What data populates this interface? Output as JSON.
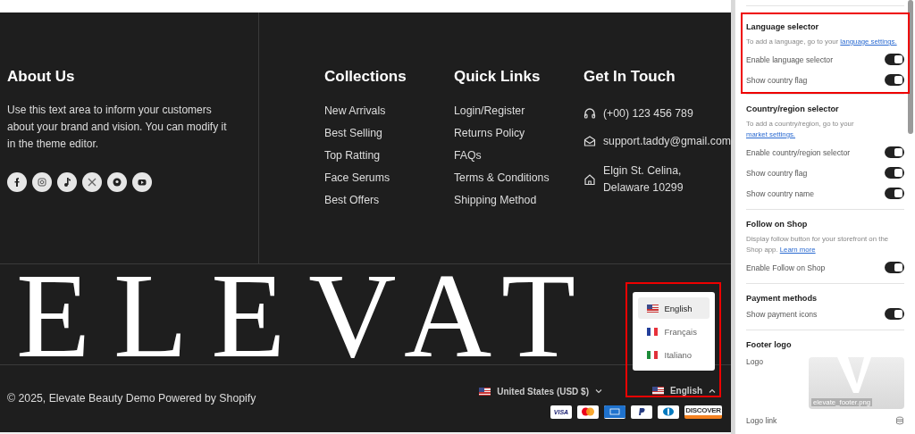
{
  "footer": {
    "about": {
      "heading": "About Us",
      "text": "Use this text area to inform your customers about your brand and vision. You can modify it in the theme editor.",
      "social": [
        {
          "kind": "facebook"
        },
        {
          "kind": "instagram"
        },
        {
          "kind": "tiktok"
        },
        {
          "kind": "x"
        },
        {
          "kind": "pinterest"
        },
        {
          "kind": "youtube"
        }
      ]
    },
    "columns": [
      {
        "heading": "Collections",
        "links": [
          "New Arrivals",
          "Best Selling",
          "Top Ratting",
          "Face Serums",
          "Best Offers"
        ]
      },
      {
        "heading": "Quick Links",
        "links": [
          "Login/Register",
          "Returns Policy",
          "FAQs",
          "Terms & Conditions",
          "Shipping Method"
        ]
      }
    ],
    "contact": {
      "heading": "Get In Touch",
      "items": [
        {
          "kind": "phone",
          "text": "(+00) 123 456 789"
        },
        {
          "kind": "email",
          "text": "support.taddy@gmail.com"
        },
        {
          "kind": "address",
          "text": "Elgin St. Celina, Delaware 10299"
        }
      ]
    },
    "logo": "ELEVAT",
    "copyright": "© 2025, Elevate Beauty Demo Powered by Shopify",
    "country_selector": {
      "label": "United States (USD $)",
      "kind": "us"
    },
    "language_selector": {
      "label": "English",
      "kind": "us",
      "expanded": true,
      "highlighted": true,
      "options": [
        {
          "label": "English",
          "kind": "us",
          "selected": true
        },
        {
          "label": "Français",
          "kind": "fr",
          "selected": false
        },
        {
          "label": "Italiano",
          "kind": "it",
          "selected": false
        }
      ]
    },
    "payment_icons": [
      {
        "kind": "visa",
        "label": "VISA"
      },
      {
        "kind": "mastercard"
      },
      {
        "kind": "amex"
      },
      {
        "kind": "paypal"
      },
      {
        "kind": "diners"
      },
      {
        "kind": "discover",
        "label": "DISCOVER"
      }
    ]
  },
  "settings_panel": {
    "sections": [
      {
        "heading": "Language selector",
        "highlighted": true,
        "description": "To add a language, go to your",
        "link": "language settings.",
        "settings": [
          {
            "kind": "toggle",
            "label": "Enable language selector",
            "on": true
          },
          {
            "kind": "toggle",
            "label": "Show country flag",
            "on": true
          }
        ]
      },
      {
        "heading": "Country/region selector",
        "highlighted": false,
        "description": "To add a country/region, go to your",
        "link": "market settings.",
        "settings": [
          {
            "kind": "toggle",
            "label": "Enable country/region selector",
            "on": true
          },
          {
            "kind": "toggle",
            "label": "Show country flag",
            "on": true
          },
          {
            "kind": "toggle",
            "label": "Show country name",
            "on": true
          }
        ]
      },
      {
        "heading": "Follow on Shop",
        "highlighted": false,
        "description": "Display follow button for your storefront on the Shop app.",
        "link": "Learn more",
        "settings": [
          {
            "kind": "toggle",
            "label": "Enable Follow on Shop",
            "on": true
          }
        ]
      },
      {
        "heading": "Payment methods",
        "highlighted": false,
        "settings": [
          {
            "kind": "toggle",
            "label": "Show payment icons",
            "on": true
          }
        ]
      },
      {
        "heading": "Footer logo",
        "highlighted": false,
        "settings": [
          {
            "kind": "image",
            "label": "Logo",
            "filename": "elevate_footer.png"
          },
          {
            "kind": "link_field",
            "label": "Logo link"
          }
        ]
      }
    ]
  }
}
